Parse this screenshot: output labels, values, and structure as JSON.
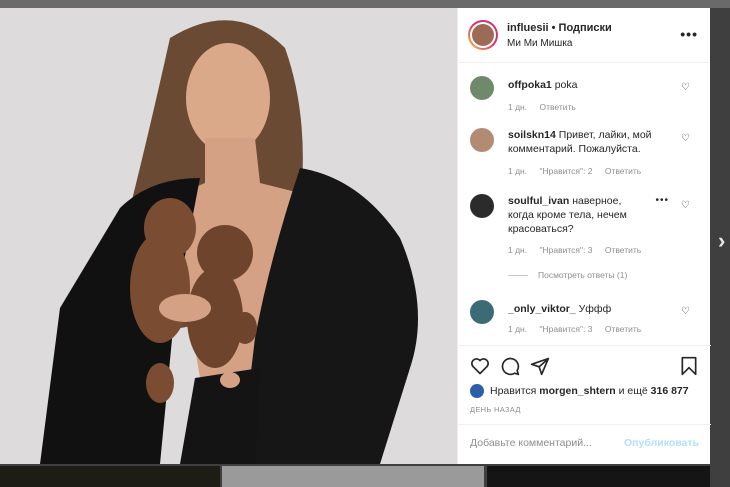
{
  "post": {
    "username": "influesii",
    "separator": "•",
    "follow_label": "Подписки",
    "subtitle": "Ми Ми Мишка",
    "more_icon": "ellipsis-icon"
  },
  "comments": [
    {
      "user": "offpoka1",
      "text": "poka",
      "time": "1 дн.",
      "likes": "",
      "reply": "Ответить"
    },
    {
      "user": "soilskn14",
      "text": "Привет, лайки, мой комментарий. Пожалуйста.",
      "time": "1 дн.",
      "likes": "\"Нравится\": 2",
      "reply": "Ответить"
    },
    {
      "user": "soulful_ivan",
      "text": "наверное, когда кроме тела, нечем красоваться?",
      "time": "1 дн.",
      "likes": "\"Нравится\": 3",
      "reply": "Ответить",
      "more": "•••"
    },
    {
      "user": "_only_viktor_",
      "text": "Уффф",
      "time": "1 дн.",
      "likes": "\"Нравится\": 3",
      "reply": "Ответить"
    }
  ],
  "view_replies": "Посмотреть ответы (1)",
  "likes": {
    "prefix": "Нравится",
    "user": "morgen_shtern",
    "middle": "и ещё",
    "count": "316 877"
  },
  "time_ago": "ДЕНЬ НАЗАД",
  "add_comment": {
    "placeholder": "Добавьте комментарий...",
    "publish": "Опубликовать"
  },
  "colors": {
    "accent": "#0095f6",
    "publish_disabled": "#b2dffc",
    "muted": "#8e8e8e"
  }
}
